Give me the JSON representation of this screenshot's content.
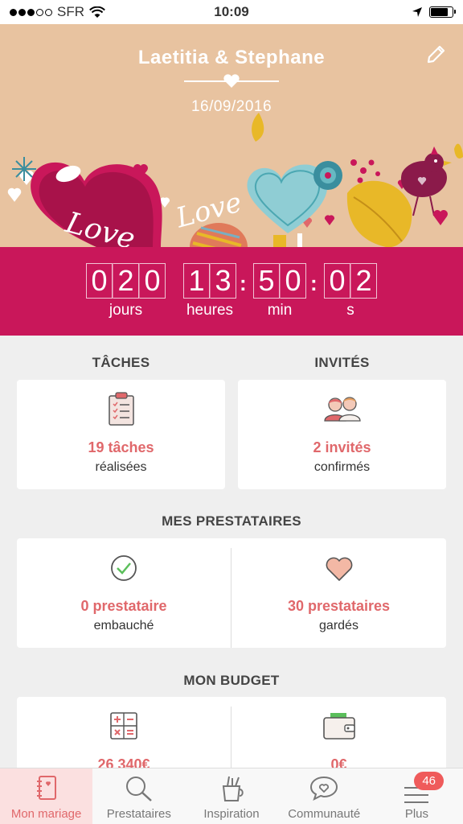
{
  "status_bar": {
    "carrier": "SFR",
    "time": "10:09"
  },
  "hero": {
    "couple": "Laetitia & Stephane",
    "date": "16/09/2016",
    "art_text_1": "Love",
    "art_text_2": "Love"
  },
  "countdown": {
    "days": [
      "0",
      "2",
      "0"
    ],
    "hours": [
      "1",
      "3"
    ],
    "minutes": [
      "5",
      "0"
    ],
    "seconds": [
      "0",
      "2"
    ],
    "labels": {
      "days": "jours",
      "hours": "heures",
      "minutes": "min",
      "seconds": "s"
    }
  },
  "tasks": {
    "title": "TÂCHES",
    "value": "19 tâches",
    "sub": "réalisées"
  },
  "guests": {
    "title": "INVITÉS",
    "value": "2 invités",
    "sub": "confirmés"
  },
  "vendors": {
    "title": "MES PRESTATAIRES",
    "hired": {
      "value": "0 prestataire",
      "sub": "embauché"
    },
    "saved": {
      "value": "30 prestataires",
      "sub": "gardés"
    }
  },
  "budget": {
    "title": "MON BUDGET",
    "estimated": "26 340€",
    "spent": "0€"
  },
  "tabs": [
    {
      "label": "Mon mariage",
      "icon": "notebook-icon"
    },
    {
      "label": "Prestataires",
      "icon": "search-icon"
    },
    {
      "label": "Inspiration",
      "icon": "pencil-cup-icon"
    },
    {
      "label": "Communauté",
      "icon": "chat-heart-icon"
    },
    {
      "label": "Plus",
      "icon": "menu-icon",
      "badge": "46"
    }
  ],
  "colors": {
    "accent": "#e0686b",
    "countdown_bg": "#c9175a",
    "hero_bg": "#e8c3a0"
  }
}
